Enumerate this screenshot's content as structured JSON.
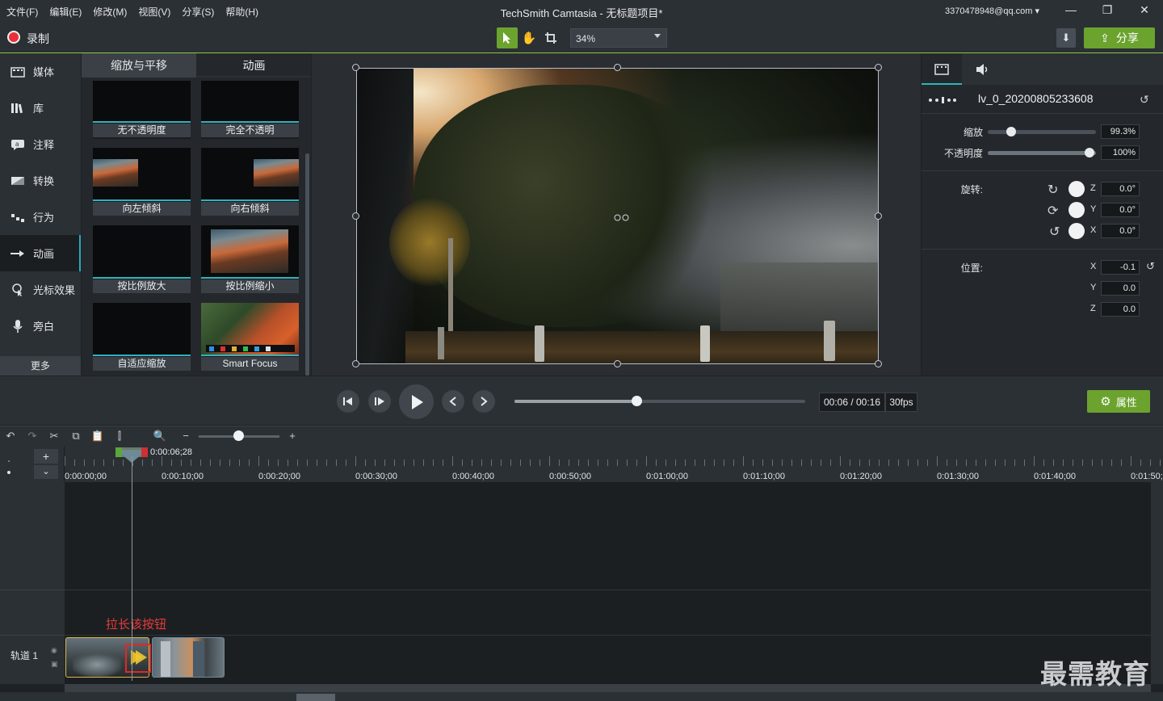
{
  "menu": [
    "文件(F)",
    "编辑(E)",
    "修改(M)",
    "视图(V)",
    "分享(S)",
    "帮助(H)"
  ],
  "app_title": "TechSmith Camtasia - 无标题项目*",
  "account": "3370478948@qq.com ▾",
  "toolbar": {
    "record_label": "录制",
    "zoom": "34%",
    "share_label": "分享"
  },
  "sidebar": {
    "items": [
      {
        "label": "媒体",
        "icon": "media-icon"
      },
      {
        "label": "库",
        "icon": "library-icon"
      },
      {
        "label": "注释",
        "icon": "annotation-icon"
      },
      {
        "label": "转换",
        "icon": "transition-icon"
      },
      {
        "label": "行为",
        "icon": "behavior-icon"
      },
      {
        "label": "动画",
        "icon": "animation-icon"
      },
      {
        "label": "光标效果",
        "icon": "cursor-effect-icon"
      },
      {
        "label": "旁白",
        "icon": "microphone-icon"
      }
    ],
    "more": "更多"
  },
  "library": {
    "tabs": [
      "缩放与平移",
      "动画"
    ],
    "tiles": [
      "无不透明度",
      "完全不透明",
      "向左倾斜",
      "向右倾斜",
      "按比例放大",
      "按比例缩小",
      "自适应缩放",
      "Smart Focus"
    ]
  },
  "properties": {
    "clip_name": "lv_0_20200805233608",
    "scale_label": "缩放",
    "scale_value": "99.3%",
    "scale_fraction": 0.22,
    "opacity_label": "不透明度",
    "opacity_value": "100%",
    "rotation_label": "旋转:",
    "rot_z": "0.0°",
    "rot_y": "0.0°",
    "rot_x": "0.0°",
    "position_label": "位置:",
    "pos_x": "-0.1",
    "pos_y": "0.0",
    "pos_z": "0.0"
  },
  "axes": {
    "z": "Z",
    "y": "Y",
    "x": "X"
  },
  "playback": {
    "timecode": "00:06 / 00:16",
    "fps": "30fps",
    "progress": 0.42,
    "attr_label": "属性"
  },
  "timeline": {
    "playhead_time": "0:00:06;28",
    "ticks": [
      "0:00:00;00",
      "0:00:10;00",
      "0:00:20;00",
      "0:00:30;00",
      "0:00:40;00",
      "0:00:50;00",
      "0:01:00;00",
      "0:01:10;00",
      "0:01:20;00",
      "0:01:30;00",
      "0:01:40;00",
      "0:01:50;00"
    ],
    "track_name": "轨道 1",
    "annotation": "拉长该按钮"
  },
  "watermark": "最需教育",
  "colors": {
    "accent": "#6ba32e",
    "highlight": "#e32626",
    "tab_active": "#2fb3c0"
  }
}
